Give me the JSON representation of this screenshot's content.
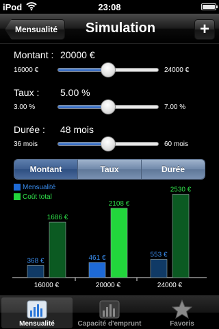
{
  "status_bar": {
    "carrier": "iPod",
    "time": "23:08"
  },
  "nav": {
    "back_label": "Mensualité",
    "title": "Simulation",
    "add_label": "+"
  },
  "montant": {
    "label": "Montant :",
    "value": "20000 €",
    "min": "16000 €",
    "max": "24000 €",
    "level": 0.5
  },
  "taux": {
    "label": "Taux :",
    "value": "5.00 %",
    "min": "3.00 %",
    "max": "7.00 %",
    "level": 0.5
  },
  "duree": {
    "label": "Durée :",
    "value": "48 mois",
    "min": "36 mois",
    "max": "60 mois",
    "level": 0.5
  },
  "segmented": {
    "items": [
      "Montant",
      "Taux",
      "Durée"
    ],
    "selected": "Montant"
  },
  "colors": {
    "mensualite": "#1e6ad6",
    "mensualite_dim": "#103a66",
    "cout": "#22d63c",
    "cout_dim": "#0b5a22",
    "bar_label_blue": "#3a8ef0",
    "bar_label_green": "#2fe04a"
  },
  "chart_data": {
    "type": "bar",
    "categories": [
      "16000 €",
      "20000 €",
      "24000 €"
    ],
    "highlighted_category": "20000 €",
    "series": [
      {
        "name": "Mensualité",
        "values": [
          368,
          461,
          553
        ],
        "labels": [
          "368 €",
          "461 €",
          "553 €"
        ]
      },
      {
        "name": "Coût total",
        "values": [
          1686,
          2108,
          2530
        ],
        "labels": [
          "1686 €",
          "2108 €",
          "2530 €"
        ]
      }
    ],
    "legend_position": "top-left",
    "ylim": [
      0,
      2750
    ]
  },
  "tabs": [
    {
      "label": "Mensualité",
      "icon": "bar-chart-icon",
      "selected": true
    },
    {
      "label": "Capacité d'emprunt",
      "icon": "bar-chart-icon",
      "selected": false
    },
    {
      "label": "Favoris",
      "icon": "star-icon",
      "selected": false
    }
  ]
}
